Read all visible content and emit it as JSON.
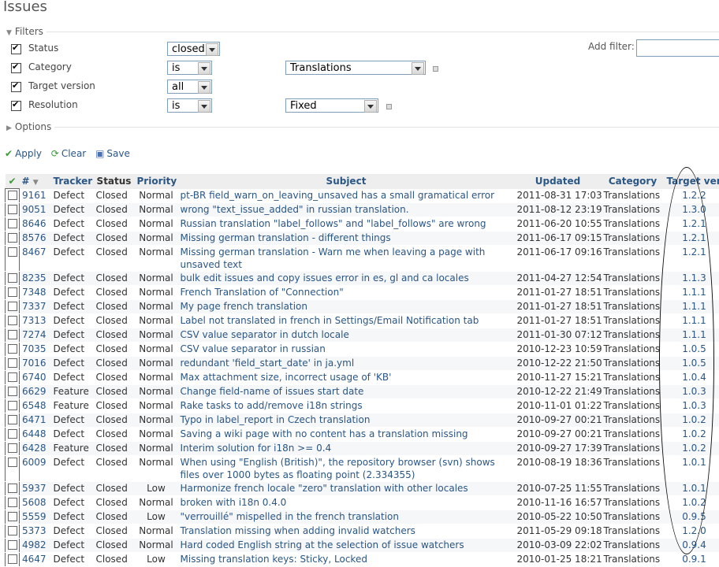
{
  "title": "Issues",
  "filters": {
    "legend": "Filters",
    "rows": [
      {
        "label": "Status",
        "operator": "closed",
        "value": ""
      },
      {
        "label": "Category",
        "operator": "is",
        "value": "Translations"
      },
      {
        "label": "Target version",
        "operator": "all",
        "value": ""
      },
      {
        "label": "Resolution",
        "operator": "is",
        "value": "Fixed"
      }
    ],
    "add_filter_label": "Add filter:"
  },
  "options": {
    "legend": "Options"
  },
  "toolbar": {
    "apply": "Apply",
    "clear": "Clear",
    "save": "Save"
  },
  "columns": {
    "id": "#",
    "tracker": "Tracker",
    "status": "Status",
    "priority": "Priority",
    "subject": "Subject",
    "updated": "Updated",
    "category": "Category",
    "target_version": "Target vers"
  },
  "issues": [
    {
      "id": "9161",
      "tracker": "Defect",
      "status": "Closed",
      "priority": "Normal",
      "subject": "pt-BR field_warn_on_leaving_unsaved has a small gramatical error",
      "updated": "2011-08-31 17:03",
      "category": "Translations",
      "version": "1.2.2"
    },
    {
      "id": "9051",
      "tracker": "Defect",
      "status": "Closed",
      "priority": "Normal",
      "subject": "wrong \"text_issue_added\" in russian translation.",
      "updated": "2011-08-12 23:19",
      "category": "Translations",
      "version": "1.3.0"
    },
    {
      "id": "8646",
      "tracker": "Defect",
      "status": "Closed",
      "priority": "Normal",
      "subject": "Russian translation \"label_follows\" and \"label_follows\" are wrong",
      "updated": "2011-06-20 10:55",
      "category": "Translations",
      "version": "1.2.1"
    },
    {
      "id": "8576",
      "tracker": "Defect",
      "status": "Closed",
      "priority": "Normal",
      "subject": "Missing german translation - different things",
      "updated": "2011-06-17 09:15",
      "category": "Translations",
      "version": "1.2.1"
    },
    {
      "id": "8467",
      "tracker": "Defect",
      "status": "Closed",
      "priority": "Normal",
      "subject": "Missing german translation - Warn me when leaving a page with unsaved text",
      "updated": "2011-06-17 09:16",
      "category": "Translations",
      "version": "1.2.1"
    },
    {
      "id": "8235",
      "tracker": "Defect",
      "status": "Closed",
      "priority": "Normal",
      "subject": "bulk edit issues and copy issues error in es, gl and ca locales",
      "updated": "2011-04-27 12:54",
      "category": "Translations",
      "version": "1.1.3"
    },
    {
      "id": "7348",
      "tracker": "Defect",
      "status": "Closed",
      "priority": "Normal",
      "subject": "French Translation of \"Connection\"",
      "updated": "2011-01-27 18:51",
      "category": "Translations",
      "version": "1.1.1"
    },
    {
      "id": "7337",
      "tracker": "Defect",
      "status": "Closed",
      "priority": "Normal",
      "subject": "My page french translation",
      "updated": "2011-01-27 18:51",
      "category": "Translations",
      "version": "1.1.1"
    },
    {
      "id": "7313",
      "tracker": "Defect",
      "status": "Closed",
      "priority": "Normal",
      "subject": "Label not translated in french in Settings/Email Notification tab",
      "updated": "2011-01-27 18:51",
      "category": "Translations",
      "version": "1.1.1"
    },
    {
      "id": "7274",
      "tracker": "Defect",
      "status": "Closed",
      "priority": "Normal",
      "subject": "CSV value separator in dutch locale",
      "updated": "2011-01-30 07:12",
      "category": "Translations",
      "version": "1.1.1"
    },
    {
      "id": "7035",
      "tracker": "Defect",
      "status": "Closed",
      "priority": "Normal",
      "subject": "CSV value separator in russian",
      "updated": "2010-12-23 10:59",
      "category": "Translations",
      "version": "1.0.5"
    },
    {
      "id": "7016",
      "tracker": "Defect",
      "status": "Closed",
      "priority": "Normal",
      "subject": "redundant 'field_start_date' in ja.yml",
      "updated": "2010-12-22 21:50",
      "category": "Translations",
      "version": "1.0.5"
    },
    {
      "id": "6740",
      "tracker": "Defect",
      "status": "Closed",
      "priority": "Normal",
      "subject": "Max attachment size, incorrect usage of 'KB'",
      "updated": "2010-11-27 15:21",
      "category": "Translations",
      "version": "1.0.4"
    },
    {
      "id": "6629",
      "tracker": "Feature",
      "status": "Closed",
      "priority": "Normal",
      "subject": "Change field-name of issues start date",
      "updated": "2010-12-22 21:49",
      "category": "Translations",
      "version": "1.0.3"
    },
    {
      "id": "6548",
      "tracker": "Feature",
      "status": "Closed",
      "priority": "Normal",
      "subject": "Rake tasks to add/remove i18n strings",
      "updated": "2010-11-01 01:22",
      "category": "Translations",
      "version": "1.0.3"
    },
    {
      "id": "6471",
      "tracker": "Defect",
      "status": "Closed",
      "priority": "Normal",
      "subject": "Typo in label_report in Czech translation",
      "updated": "2010-09-27 00:21",
      "category": "Translations",
      "version": "1.0.2"
    },
    {
      "id": "6448",
      "tracker": "Defect",
      "status": "Closed",
      "priority": "Normal",
      "subject": "Saving a wiki page with no content has a translation missing",
      "updated": "2010-09-27 00:21",
      "category": "Translations",
      "version": "1.0.2"
    },
    {
      "id": "6428",
      "tracker": "Feature",
      "status": "Closed",
      "priority": "Normal",
      "subject": "Interim solution for i18n >= 0.4",
      "updated": "2010-09-27 17:39",
      "category": "Translations",
      "version": "1.0.2"
    },
    {
      "id": "6009",
      "tracker": "Defect",
      "status": "Closed",
      "priority": "Normal",
      "subject": "When using \"English (British)\", the repository browser (svn) shows files over 1000 bytes as floating point (2.334355)",
      "updated": "2010-08-19 18:36",
      "category": "Translations",
      "version": "1.0.1"
    },
    {
      "id": "5937",
      "tracker": "Defect",
      "status": "Closed",
      "priority": "Low",
      "subject": "Harmonize french locale \"zero\" translation with other locales",
      "updated": "2010-07-25 11:55",
      "category": "Translations",
      "version": "1.0.1"
    },
    {
      "id": "5608",
      "tracker": "Defect",
      "status": "Closed",
      "priority": "Normal",
      "subject": "broken with i18n 0.4.0",
      "updated": "2010-11-16 16:57",
      "category": "Translations",
      "version": "1.0.2"
    },
    {
      "id": "5559",
      "tracker": "Defect",
      "status": "Closed",
      "priority": "Low",
      "subject": "\"verrouillé\" mispelled in the french translation",
      "updated": "2010-05-22 10:50",
      "category": "Translations",
      "version": "0.9.5"
    },
    {
      "id": "5373",
      "tracker": "Defect",
      "status": "Closed",
      "priority": "Normal",
      "subject": "Translation missing when adding invalid watchers",
      "updated": "2011-05-29 09:18",
      "category": "Translations",
      "version": "1.2.0"
    },
    {
      "id": "4982",
      "tracker": "Defect",
      "status": "Closed",
      "priority": "Normal",
      "subject": "Hard coded English string at the selection of issue watchers",
      "updated": "2010-03-09 22:02",
      "category": "Translations",
      "version": "0.9.4"
    },
    {
      "id": "4647",
      "tracker": "Defect",
      "status": "Closed",
      "priority": "Low",
      "subject": "Missing translation keys: Sticky, Locked",
      "updated": "2010-01-25 18:21",
      "category": "Translations",
      "version": "0.9.1"
    }
  ]
}
